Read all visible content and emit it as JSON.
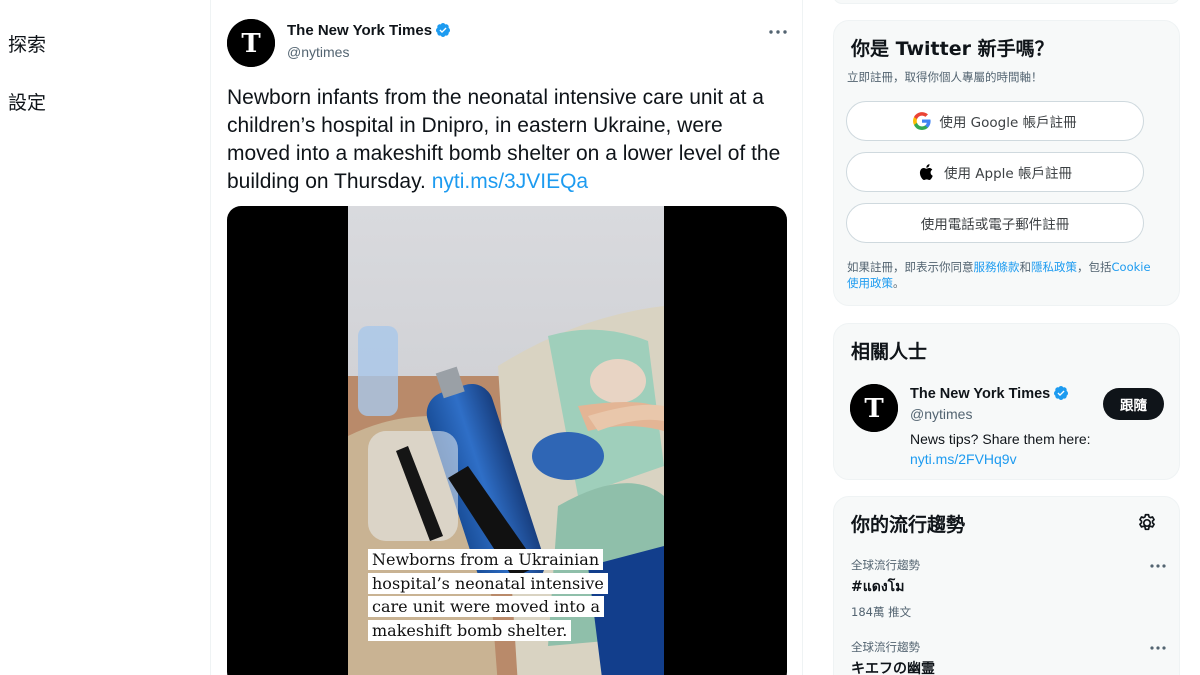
{
  "nav": {
    "items": [
      {
        "label": "探索"
      },
      {
        "label": "設定"
      }
    ]
  },
  "tweet": {
    "author_name": "The New York Times",
    "author_handle": "@nytimes",
    "text": "Newborn infants from the neonatal intensive care unit at a children’s hospital in Dnipro, in eastern Ukraine, were moved into a makeshift bomb shelter on a lower level of the building on Thursday.",
    "link": "nyti.ms/3JVIEQa",
    "media_caption": "Newborns from a Ukrainian hospital’s neonatal intensive care unit were moved into a makeshift bomb shelter.",
    "icons": {
      "avatar": "nyt-logo-icon",
      "verified": "verified-badge-icon",
      "more": "more-icon"
    }
  },
  "signup": {
    "title": "你是 Twitter 新手嗎？",
    "subtitle": "立即註冊，取得你個人專屬的時間軸！",
    "google_label": "使用 Google 帳戶註冊",
    "apple_label": "使用 Apple 帳戶註冊",
    "phone_label": "使用電話或電子郵件註冊",
    "terms_prefix": "如果註冊，即表示你同意",
    "terms_link": "服務條款",
    "terms_and": "和",
    "privacy_link": "隱私政策",
    "terms_mid": "，包括",
    "cookie_link": "Cookie 使用政策",
    "terms_end": "。"
  },
  "who_to_follow": {
    "title": "相關人士",
    "name": "The New York Times",
    "handle": "@nytimes",
    "bio": "News tips? Share them here:",
    "bio_link": "nyti.ms/2FVHq9v",
    "follow_label": "跟隨"
  },
  "trends": {
    "title": "你的流行趨勢",
    "items": [
      {
        "context": "全球流行趨勢",
        "name": "#แดงโม",
        "count": "184萬 推文"
      },
      {
        "context": "全球流行趨勢",
        "name": "キエフの幽霊",
        "count": ""
      }
    ]
  },
  "colors": {
    "accent": "#1d9bf0",
    "text": "#0f1419",
    "secondary": "#536471",
    "card_bg": "#f7f9f9"
  }
}
